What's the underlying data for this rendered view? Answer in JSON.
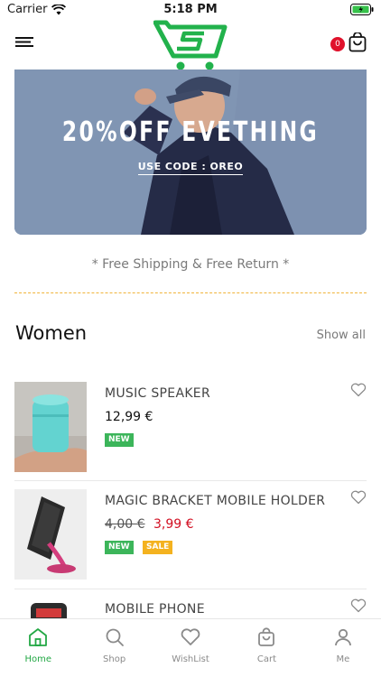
{
  "status_bar": {
    "carrier": "Carrier",
    "time": "5:18 PM"
  },
  "header": {
    "cart_count": "0"
  },
  "banner": {
    "title": "20%OFF EVETHING",
    "code": "USE CODE : OREO"
  },
  "shipping_text": "* Free Shipping & Free Return *",
  "section": {
    "title": "Women",
    "show_all": "Show all"
  },
  "products": [
    {
      "name": "MUSIC SPEAKER",
      "price": "12,99 €",
      "badges": [
        "NEW"
      ]
    },
    {
      "name": "MAGIC BRACKET MOBILE HOLDER",
      "old_price": "4,00 €",
      "sale_price": "3,99 €",
      "badges": [
        "NEW",
        "SALE"
      ]
    },
    {
      "name": "MOBILE PHONE"
    }
  ],
  "tabs": [
    {
      "label": "Home",
      "icon": "home-icon",
      "active": true
    },
    {
      "label": "Shop",
      "icon": "search-icon"
    },
    {
      "label": "WishList",
      "icon": "heart-icon"
    },
    {
      "label": "Cart",
      "icon": "bag-icon"
    },
    {
      "label": "Me",
      "icon": "user-icon"
    }
  ],
  "colors": {
    "accent": "#23a845",
    "sale": "#d20f22",
    "badge_new": "#3cb55a",
    "badge_sale": "#f4b21f",
    "cart_badge": "#e0112b"
  }
}
